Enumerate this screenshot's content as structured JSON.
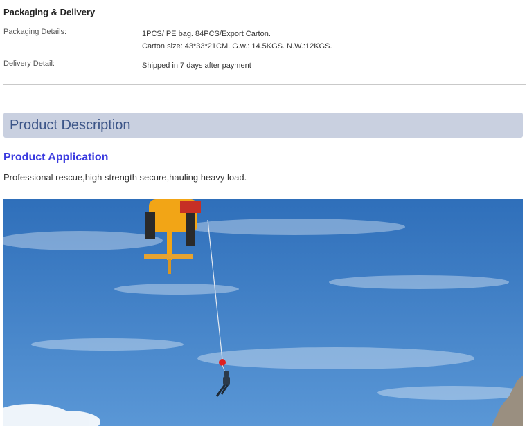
{
  "packaging": {
    "heading": "Packaging & Delivery",
    "details_label": "Packaging Details:",
    "details_line1": "1PCS/ PE bag. 84PCS/Export Carton.",
    "details_line2": "Carton size: 43*33*21CM. G.w.: 14.5KGS. N.W.:12KGS.",
    "delivery_label": "Delivery Detail:",
    "delivery_value": "Shipped in 7 days after payment"
  },
  "description": {
    "heading": "Product Description",
    "application_title": "Product Application",
    "application_text": "Professional rescue,high strength secure,hauling heavy load."
  },
  "photo": {
    "subject": "helicopter rescue hoist with person on cable against blue sky",
    "colors": {
      "sky": "#3f7fc6",
      "helicopter": "#f2a516",
      "rope_device": "#e02020"
    }
  }
}
